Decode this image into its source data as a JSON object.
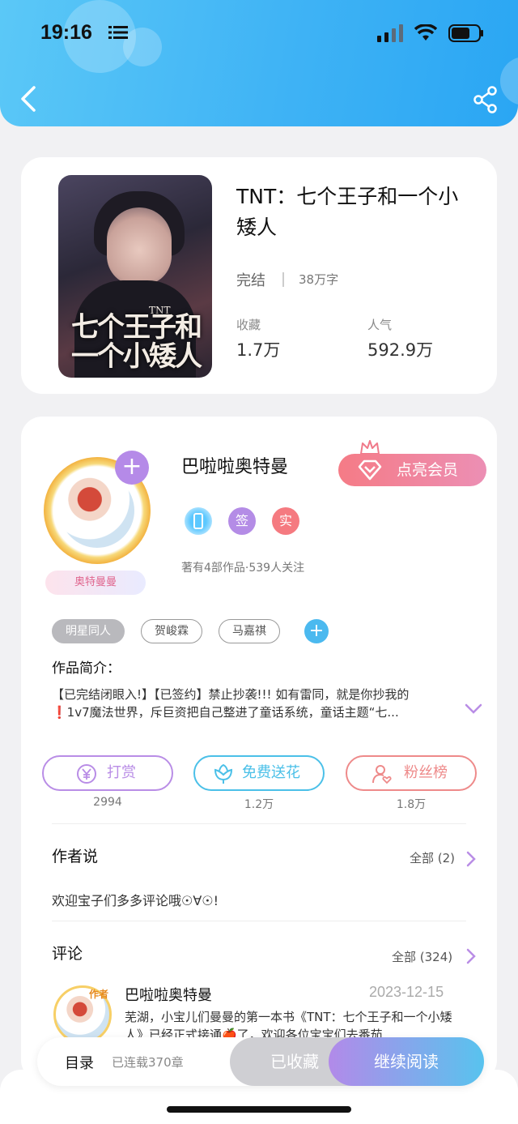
{
  "status_bar": {
    "time": "19:16"
  },
  "book": {
    "title": "TNT：七个王子和一个小矮人",
    "cover_title": "七个王子和一个小矮人",
    "cover_tnt": "TNT",
    "status": "完结",
    "word_count": "38万字",
    "collect_label": "收藏",
    "collect_value": "1.7万",
    "popularity_label": "人气",
    "popularity_value": "592.9万"
  },
  "author": {
    "name": "巴啦啦奥特曼",
    "avatar_badge": "奥特曼曼",
    "vip_button": "点亮会员",
    "badge_sign": "签",
    "badge_real": "实",
    "meta": "著有4部作品·539人关注"
  },
  "tags": [
    "明星同人",
    "贺峻霖",
    "马嘉祺"
  ],
  "intro": {
    "title": "作品简介：",
    "line1": "【已完结闭眼入!】【已签约】禁止抄袭!!! 如有雷同，就是你抄我的",
    "line2": "❗1v7魔法世界，斥巨资把自己整进了童话系统，童话主题“七..."
  },
  "actions": [
    {
      "label": "打赏",
      "count": "2994",
      "color": "#b98de6"
    },
    {
      "label": "免费送花",
      "count": "1.2万",
      "color": "#4bc0e8"
    },
    {
      "label": "粉丝榜",
      "count": "1.8万",
      "color": "#ee8a8a"
    }
  ],
  "author_says": {
    "title": "作者说",
    "all": "全部 (2)",
    "text": "欢迎宝子们多多评论哦☉∀☉!"
  },
  "comments": {
    "title": "评论",
    "all": "全部 (324)",
    "item": {
      "tag": "作者",
      "name": "巴啦啦奥特曼",
      "date": "2023-12-15",
      "text": "芜湖，小宝儿们曼曼的第一本书《TNT：七个王子和一个小矮人》已经正式接通🍎了，欢迎各位宝宝们去番茄"
    }
  },
  "bottom_bar": {
    "toc": "目录",
    "serial": "已连载370章",
    "collected": "已收藏",
    "continue": "继续阅读"
  }
}
